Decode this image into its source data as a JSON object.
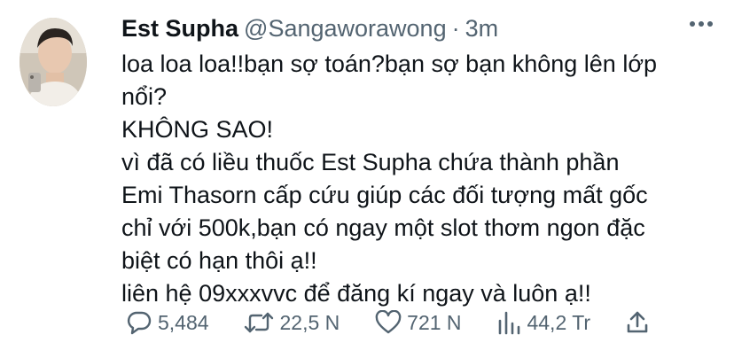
{
  "tweet": {
    "author_name": "Est Supha",
    "handle": "@Sangaworawong",
    "separator": "·",
    "time": "3m",
    "lines": [
      "loa loa loa!!bạn sợ toán?bạn sợ bạn không lên lớp",
      "nổi?",
      "KHÔNG SAO!",
      "vì đã có liều thuốc Est Supha chứa thành phần",
      "Emi Thasorn cấp cứu giúp các đối tượng mất gốc",
      "chỉ với 500k,bạn có ngay một slot thơm ngon đặc",
      "biệt có hạn thôi ạ!!",
      "liên hệ 09xxxvvc để đăng kí ngay và luôn ạ!!"
    ]
  },
  "actions": {
    "replies": "5,484",
    "retweets": "22,5 N",
    "likes": "721 N",
    "views": "44,2 Tr"
  },
  "icons": {
    "reply": "reply-bubble-icon",
    "retweet": "retweet-icon",
    "like": "heart-icon",
    "views": "views-bar-chart-icon",
    "share": "share-upload-icon",
    "more": "more-dots-icon"
  },
  "colors": {
    "text_primary": "#0f1419",
    "text_secondary": "#536471",
    "background": "#ffffff"
  }
}
